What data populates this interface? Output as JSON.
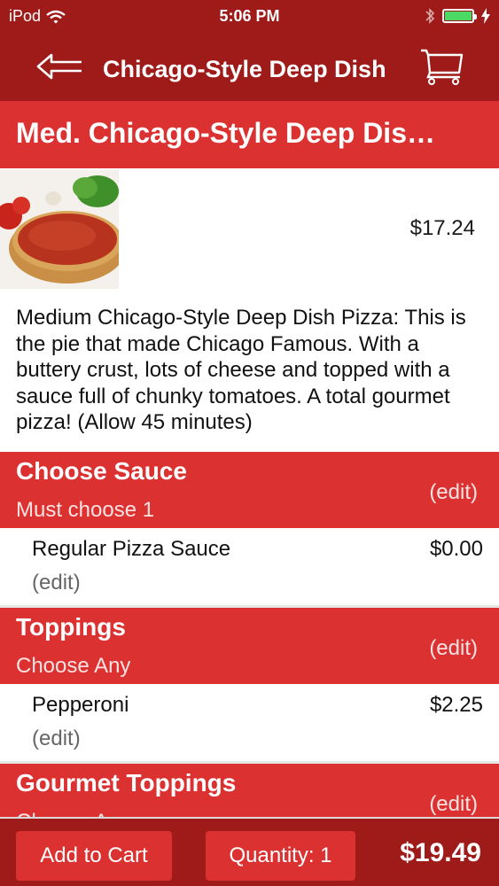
{
  "status_bar": {
    "carrier": "iPod",
    "time": "5:06 PM"
  },
  "nav": {
    "title": "Chicago-Style Deep Dish",
    "back_icon": "back-arrow-icon",
    "cart_icon": "cart-icon"
  },
  "product": {
    "title": "Med. Chicago-Style Deep Dis…",
    "price": "$17.24",
    "description": "Medium  Chicago-Style Deep Dish Pizza: This is the pie that made Chicago Famous. With a buttery crust, lots of cheese and topped with a sauce full of chunky tomatoes. A total gourmet pizza! (Allow 45 minutes)"
  },
  "sections": [
    {
      "title": "Choose Sauce",
      "subtitle": "Must choose 1",
      "edit": "(edit)",
      "item": {
        "name": "Regular Pizza Sauce",
        "price": "$0.00",
        "edit": "(edit)"
      }
    },
    {
      "title": "Toppings",
      "subtitle": "Choose Any",
      "edit": "(edit)",
      "item": {
        "name": "Pepperoni",
        "price": "$2.25",
        "edit": "(edit)"
      }
    },
    {
      "title": "Gourmet Toppings",
      "subtitle": "Choose Any",
      "edit": "(edit)"
    }
  ],
  "bottom": {
    "add_to_cart": "Add to Cart",
    "quantity": "Quantity: 1",
    "total": "$19.49"
  },
  "colors": {
    "nav_bg": "#9e1b1a",
    "section_bg": "#dc3131",
    "battery": "#4cd964"
  }
}
